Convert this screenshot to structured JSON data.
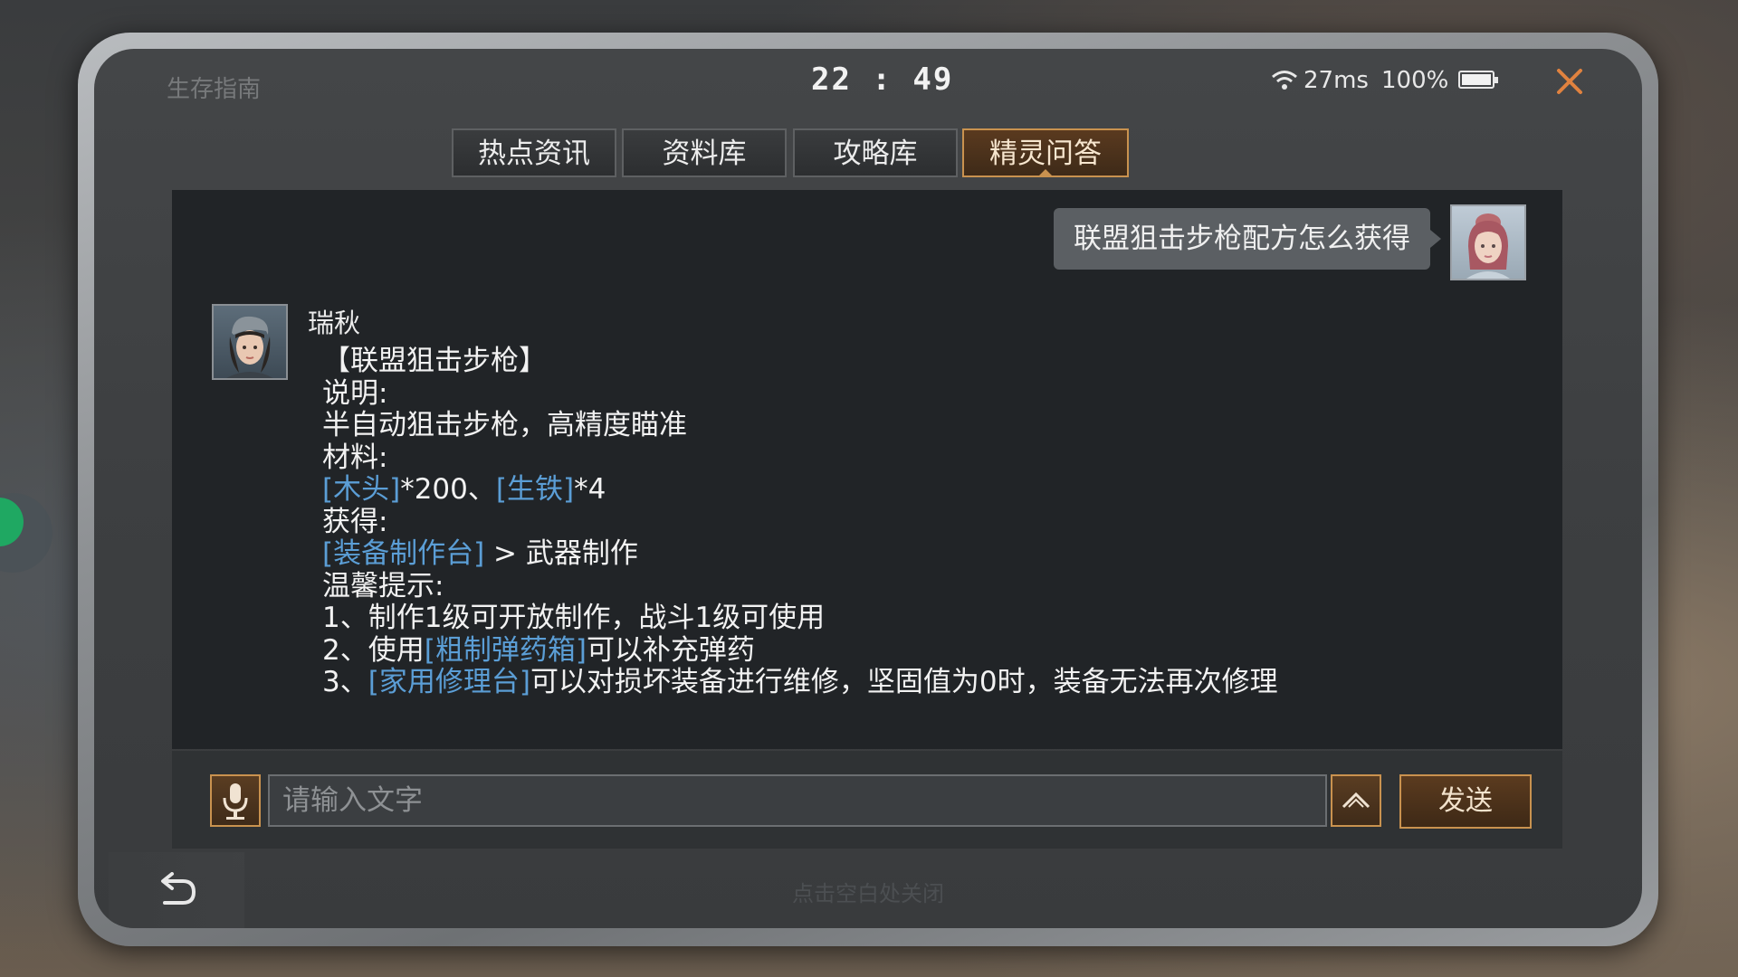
{
  "app": {
    "title": "生存指南"
  },
  "status": {
    "time": "22 : 49",
    "ping": "27ms",
    "battery": "100%"
  },
  "tabs": [
    {
      "label": "热点资讯",
      "active": false
    },
    {
      "label": "资料库",
      "active": false
    },
    {
      "label": "攻略库",
      "active": false
    },
    {
      "label": "精灵问答",
      "active": true
    }
  ],
  "chat": {
    "user_question": "联盟狙击步枪配方怎么获得",
    "bot_name": "瑞秋",
    "answer": {
      "title": "【联盟狙击步枪】",
      "desc_label": "说明:",
      "desc": "半自动狙击步枪，高精度瞄准",
      "materials_label": "材料:",
      "material_1": "[木头]",
      "material_1_qty": "*200、",
      "material_2": "[生铁]",
      "material_2_qty": "*4",
      "obtain_label": "获得:",
      "obtain_link": "[装备制作台]",
      "obtain_suffix": " > 武器制作",
      "tips_label": "温馨提示:",
      "tip_1": "1、制作1级可开放制作，战斗1级可使用",
      "tip_2_prefix": "2、使用",
      "tip_2_link": "[粗制弹药箱]",
      "tip_2_suffix": "可以补充弹药",
      "tip_3_prefix": "3、",
      "tip_3_link": "[家用修理台]",
      "tip_3_suffix": "可以对损坏装备进行维修，坚固值为0时，装备无法再次修理"
    }
  },
  "input": {
    "placeholder": "请输入文字",
    "send_label": "发送"
  },
  "footer": {
    "close_hint": "点击空白处关闭"
  },
  "icons": {
    "wifi": "wifi-icon",
    "battery": "battery-icon",
    "close": "close-icon",
    "mic": "microphone-icon",
    "expand": "chevron-up-icon",
    "back": "back-arrow-icon"
  },
  "colors": {
    "accent": "#c9924f",
    "link": "#5b9ed6",
    "close_x": "#e0823f",
    "panel": "#212427"
  }
}
